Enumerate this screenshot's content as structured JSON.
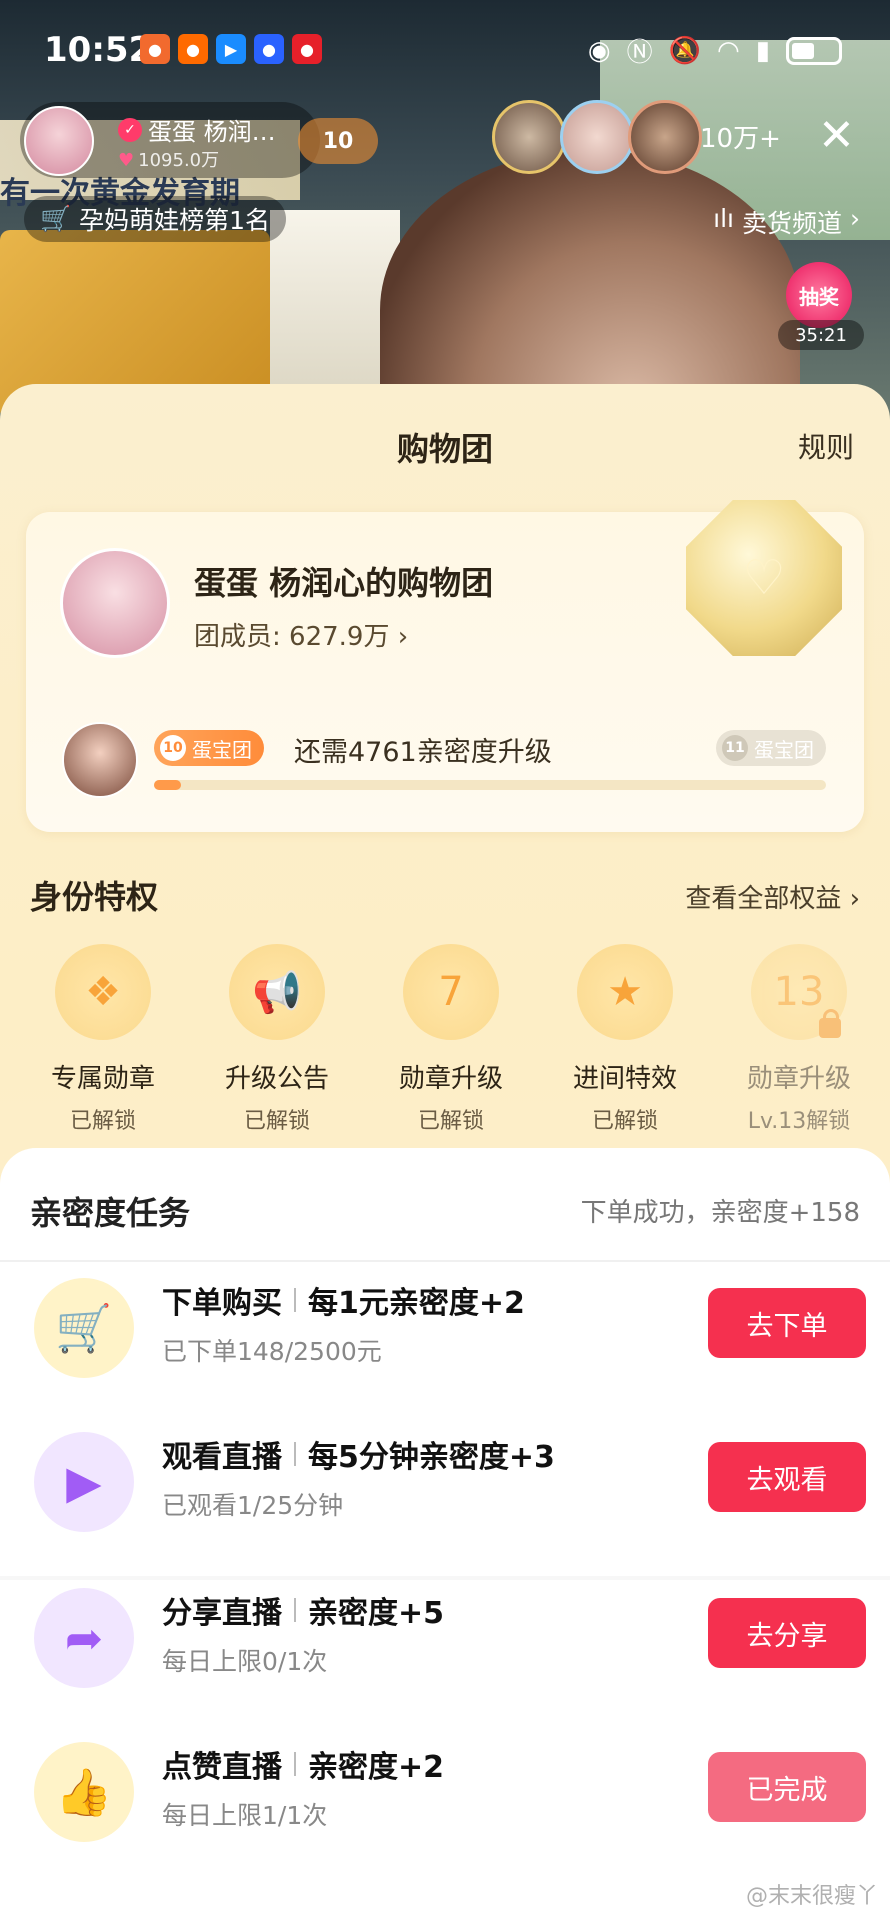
{
  "status_bar": {
    "time": "10:52"
  },
  "stream": {
    "streamer_name": "蛋蛋 杨润…",
    "likes": "1095.0万",
    "fan_level": "10",
    "viewer_count": "10万+",
    "rank": "孕妈萌娃榜第1名",
    "channel": "卖货频道",
    "lottery_label": "抽奖",
    "lottery_time": "35:21",
    "bg_text": "有一次黄金发育期"
  },
  "sheet": {
    "title": "购物团",
    "rules": "规则",
    "group": {
      "name": "蛋蛋 杨润心的购物团",
      "members": "团成员: 627.9万",
      "current_level_num": "10",
      "current_level_label": "蛋宝团",
      "upgrade_text": "还需4761亲密度升级",
      "next_level_num": "11",
      "next_level_label": "蛋宝团",
      "progress": 0.04
    },
    "privileges": {
      "title": "身份特权",
      "view_all": "查看全部权益",
      "items": [
        {
          "name": "专属勋章",
          "status": "已解锁",
          "icon": "medal-icon",
          "glyph": "❖"
        },
        {
          "name": "升级公告",
          "status": "已解锁",
          "icon": "megaphone-icon",
          "glyph": "📢"
        },
        {
          "name": "勋章升级",
          "status": "已解锁",
          "icon": "heart-badge-icon",
          "glyph": "7"
        },
        {
          "name": "进间特效",
          "status": "已解锁",
          "icon": "star-icon",
          "glyph": "★"
        },
        {
          "name": "勋章升级",
          "status": "Lv.13解锁",
          "icon": "locked-heart-icon",
          "glyph": "13"
        }
      ]
    },
    "tasks": {
      "title": "亲密度任务",
      "note": "下单成功，亲密度+158",
      "items": [
        {
          "name": "下单购买",
          "reward": "每1元亲密度+2",
          "progress": "已下单148/2500元",
          "button": "去下单",
          "icon": "cart-icon",
          "glyph": "🛒",
          "tone": "yellow",
          "done": false
        },
        {
          "name": "观看直播",
          "reward": "每5分钟亲密度+3",
          "progress": "已观看1/25分钟",
          "button": "去观看",
          "icon": "video-icon",
          "glyph": "▶",
          "tone": "purple",
          "done": false
        },
        {
          "name": "分享直播",
          "reward": "亲密度+5",
          "progress": "每日上限0/1次",
          "button": "去分享",
          "icon": "share-icon",
          "glyph": "➦",
          "tone": "purple",
          "done": false
        },
        {
          "name": "点赞直播",
          "reward": "亲密度+2",
          "progress": "每日上限1/1次",
          "button": "已完成",
          "icon": "thumbs-up-icon",
          "glyph": "👍",
          "tone": "yellow",
          "done": true
        }
      ]
    }
  },
  "watermark": "@末末很瘦丫"
}
